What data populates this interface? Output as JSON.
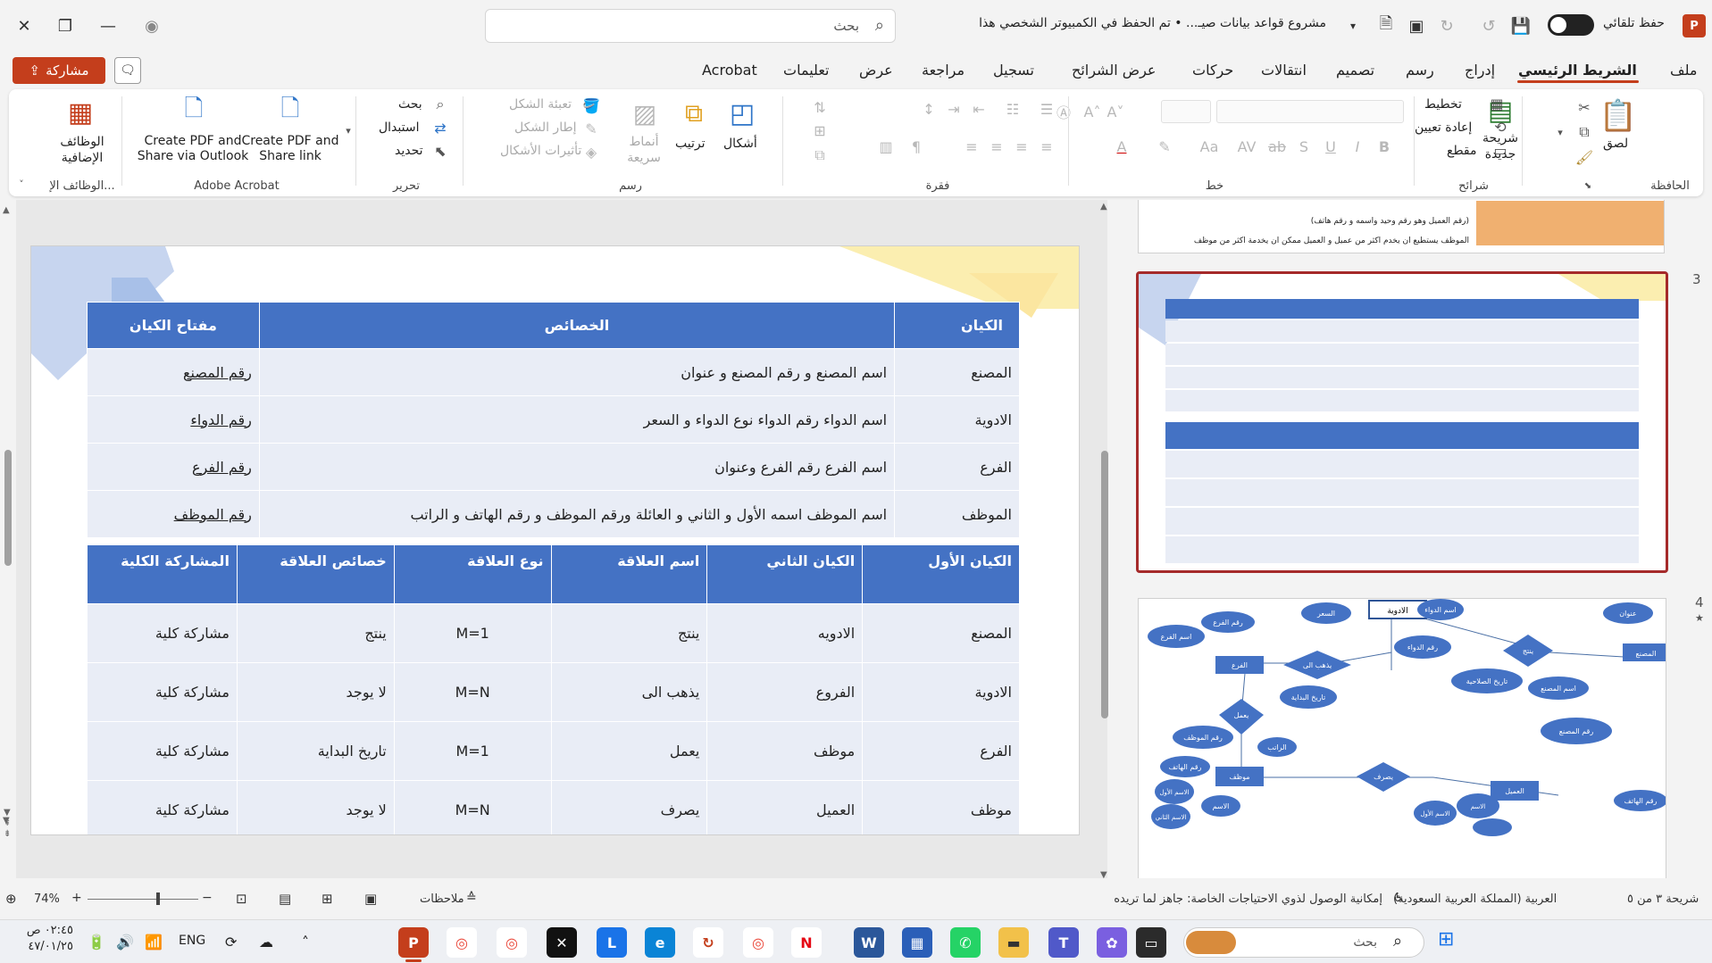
{
  "titlebar": {
    "search_placeholder": "بحث",
    "doc_title": "مشروع قواعد بيانات صيـ...  •  تم الحفظ في الكمبيوتر الشخصي هذا",
    "autosave_label": "حفظ تلقائي"
  },
  "share_label": "مشاركة",
  "tabs": [
    "ملف",
    "الشريط الرئيسي",
    "إدراج",
    "رسم",
    "تصميم",
    "انتقالات",
    "حركات",
    "عرض الشرائح",
    "تسجيل",
    "مراجعة",
    "عرض",
    "تعليمات",
    "Acrobat"
  ],
  "ribbon": {
    "clipboard": {
      "group": "الحافظة",
      "paste": "لصق"
    },
    "slides": {
      "group": "شرائح",
      "new_slide": "شريحة جديدة",
      "layout": "تخطيط",
      "reset": "إعادة تعيين",
      "section": "مقطع"
    },
    "font": {
      "group": "خط"
    },
    "paragraph": {
      "group": "فقرة"
    },
    "drawing": {
      "group": "رسم",
      "shapes": "أشكال",
      "arrange": "ترتيب",
      "quick_styles": "أنماط سريعة",
      "fill": "تعبئة الشكل",
      "outline": "إطار الشكل",
      "effects": "تأثيرات الأشكال"
    },
    "editing": {
      "group": "تحرير",
      "find": "بحث",
      "replace": "استبدال",
      "select": "تحديد"
    },
    "acrobat": {
      "group": "Adobe Acrobat",
      "create_share": "Create PDF and Share link",
      "create_outlook": "Create PDF and Share via Outlook"
    },
    "addins": {
      "group": "الوظائف الإ...",
      "label": "الوظائف الإضافية"
    }
  },
  "entity_table": {
    "headers": [
      "الكيان",
      "الخصائص",
      "مفتاح الكيان"
    ],
    "rows": [
      [
        "المصنع",
        "اسم المصنع و رقم المصنع و عنوان",
        "رقم المصنع"
      ],
      [
        "الادوية",
        "اسم الدواء  رقم الدواء  نوع الدواء و السعر",
        "رقم الدواء"
      ],
      [
        "الفرع",
        "اسم الفرع رقم الفرع وعنوان",
        "رقم الفرع"
      ],
      [
        "الموظف",
        "اسم الموظف اسمه الأول و الثاني و العائلة ورقم الموظف و رقم الهاتف و الراتب",
        "رقم الموظف"
      ]
    ]
  },
  "relationship_table": {
    "headers": [
      "الكيان الأول",
      "الكيان الثاني",
      "اسم العلاقة",
      "نوع العلاقة",
      "خصائص العلاقة",
      "المشاركة الكلية"
    ],
    "rows": [
      [
        "المصنع",
        "الادويه",
        "ينتج",
        "1=M",
        "ينتج",
        "مشاركة كلية"
      ],
      [
        "الادوية",
        "الفروع",
        "يذهب الى",
        "M=N",
        "لا يوجد",
        "مشاركة كلية"
      ],
      [
        "الفرع",
        "موظف",
        "يعمل",
        "1=M",
        "تاريخ البداية",
        "مشاركة كلية"
      ],
      [
        "موظف",
        "العميل",
        "يصرف",
        "M=N",
        "لا يوجد",
        "مشاركة كلية"
      ]
    ]
  },
  "thumbnails": {
    "slide3_number": "3",
    "slide4_number": "4",
    "slide2_text": [
      "(رقم العميل وهو رقم وحيد واسمه و رقم هاتف)",
      "الموظف يستطيع ان يخدم اكثر من عميل و العميل ممكن ان يخدمة اكثر من موظف"
    ],
    "er_nodes": [
      "الادوية",
      "السعر",
      "اسم الدواء",
      "عنوان",
      "ينتج",
      "المصنع",
      "رقم الفرع",
      "اسم الفرع",
      "الفرع",
      "يذهب الى",
      "رقم الدواء",
      "تاريخ الصلاحية",
      "اسم المصنع",
      "رقم المصنع",
      "يعمل",
      "تاريخ البداية",
      "رقم الموظف",
      "الراتب",
      "رقم الهاتف",
      "موظف",
      "يصرف",
      "العميل",
      "رقم الهاتف",
      "الاسم الأول",
      "الاسم",
      "الاسم الثاني",
      "الاسم الأول",
      "الاسم"
    ]
  },
  "statusbar": {
    "slide_info": "شريحة ٣ من ٥",
    "language": "العربية (المملكة العربية السعودية)",
    "accessibility": "إمكانية الوصول لذوي الاحتياجات الخاصة: جاهز لما تريده",
    "notes": "ملاحظات",
    "zoom": "74%"
  },
  "taskbar": {
    "search_placeholder": "بحث",
    "time": "٠٢:٤٥ ص",
    "date": "٤٧/٠١/٢٥",
    "lang": "ENG"
  }
}
